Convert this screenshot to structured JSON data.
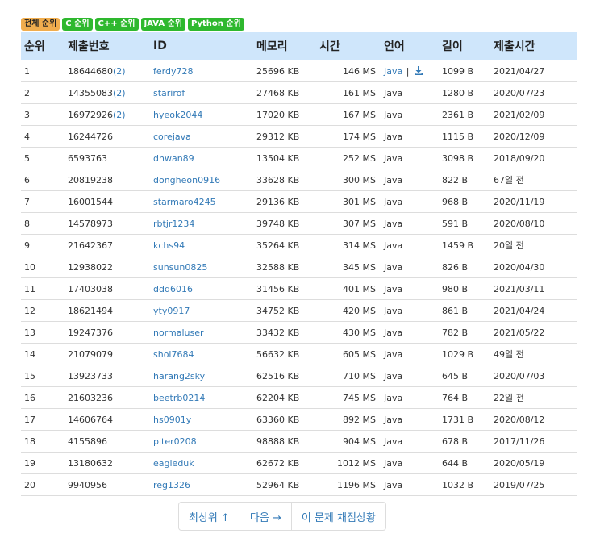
{
  "tabs": [
    {
      "label": "전체 순위",
      "color": "#f0ad4e"
    },
    {
      "label": "C 순위",
      "color": "#2eb82e"
    },
    {
      "label": "C++ 순위",
      "color": "#2eb82e"
    },
    {
      "label": "JAVA 순위",
      "color": "#2eb82e"
    },
    {
      "label": "Python 순위",
      "color": "#2eb82e"
    }
  ],
  "table": {
    "headers": [
      "순위",
      "제출번호",
      "ID",
      "메모리",
      "시간",
      "언어",
      "길이",
      "제출시간"
    ],
    "rows": [
      {
        "rank": "1",
        "submission": "18644680",
        "extra": "(2)",
        "id": "ferdy728",
        "memory": "25696 KB",
        "time": "146 MS",
        "lang": "Java",
        "download": true,
        "length": "1099 B",
        "submitted": "2021/04/27"
      },
      {
        "rank": "2",
        "submission": "14355083",
        "extra": "(2)",
        "id": "starirof",
        "memory": "27468 KB",
        "time": "161 MS",
        "lang": "Java",
        "download": false,
        "length": "1280 B",
        "submitted": "2020/07/23"
      },
      {
        "rank": "3",
        "submission": "16972926",
        "extra": "(2)",
        "id": "hyeok2044",
        "memory": "17020 KB",
        "time": "167 MS",
        "lang": "Java",
        "download": false,
        "length": "2361 B",
        "submitted": "2021/02/09"
      },
      {
        "rank": "4",
        "submission": "16244726",
        "extra": "",
        "id": "corejava",
        "memory": "29312 KB",
        "time": "174 MS",
        "lang": "Java",
        "download": false,
        "length": "1115 B",
        "submitted": "2020/12/09"
      },
      {
        "rank": "5",
        "submission": "6593763",
        "extra": "",
        "id": "dhwan89",
        "memory": "13504 KB",
        "time": "252 MS",
        "lang": "Java",
        "download": false,
        "length": "3098 B",
        "submitted": "2018/09/20"
      },
      {
        "rank": "6",
        "submission": "20819238",
        "extra": "",
        "id": "dongheon0916",
        "memory": "33628 KB",
        "time": "300 MS",
        "lang": "Java",
        "download": false,
        "length": "822 B",
        "submitted": "67일 전"
      },
      {
        "rank": "7",
        "submission": "16001544",
        "extra": "",
        "id": "starmaro4245",
        "memory": "29136 KB",
        "time": "301 MS",
        "lang": "Java",
        "download": false,
        "length": "968 B",
        "submitted": "2020/11/19"
      },
      {
        "rank": "8",
        "submission": "14578973",
        "extra": "",
        "id": "rbtjr1234",
        "memory": "39748 KB",
        "time": "307 MS",
        "lang": "Java",
        "download": false,
        "length": "591 B",
        "submitted": "2020/08/10"
      },
      {
        "rank": "9",
        "submission": "21642367",
        "extra": "",
        "id": "kchs94",
        "memory": "35264 KB",
        "time": "314 MS",
        "lang": "Java",
        "download": false,
        "length": "1459 B",
        "submitted": "20일 전"
      },
      {
        "rank": "10",
        "submission": "12938022",
        "extra": "",
        "id": "sunsun0825",
        "memory": "32588 KB",
        "time": "345 MS",
        "lang": "Java",
        "download": false,
        "length": "826 B",
        "submitted": "2020/04/30"
      },
      {
        "rank": "11",
        "submission": "17403038",
        "extra": "",
        "id": "ddd6016",
        "memory": "31456 KB",
        "time": "401 MS",
        "lang": "Java",
        "download": false,
        "length": "980 B",
        "submitted": "2021/03/11"
      },
      {
        "rank": "12",
        "submission": "18621494",
        "extra": "",
        "id": "yty0917",
        "memory": "34752 KB",
        "time": "420 MS",
        "lang": "Java",
        "download": false,
        "length": "861 B",
        "submitted": "2021/04/24"
      },
      {
        "rank": "13",
        "submission": "19247376",
        "extra": "",
        "id": "normaluser",
        "memory": "33432 KB",
        "time": "430 MS",
        "lang": "Java",
        "download": false,
        "length": "782 B",
        "submitted": "2021/05/22"
      },
      {
        "rank": "14",
        "submission": "21079079",
        "extra": "",
        "id": "shol7684",
        "memory": "56632 KB",
        "time": "605 MS",
        "lang": "Java",
        "download": false,
        "length": "1029 B",
        "submitted": "49일 전"
      },
      {
        "rank": "15",
        "submission": "13923733",
        "extra": "",
        "id": "harang2sky",
        "memory": "62516 KB",
        "time": "710 MS",
        "lang": "Java",
        "download": false,
        "length": "645 B",
        "submitted": "2020/07/03"
      },
      {
        "rank": "16",
        "submission": "21603236",
        "extra": "",
        "id": "beetrb0214",
        "memory": "62204 KB",
        "time": "745 MS",
        "lang": "Java",
        "download": false,
        "length": "764 B",
        "submitted": "22일 전"
      },
      {
        "rank": "17",
        "submission": "14606764",
        "extra": "",
        "id": "hs0901y",
        "memory": "63360 KB",
        "time": "892 MS",
        "lang": "Java",
        "download": false,
        "length": "1731 B",
        "submitted": "2020/08/12"
      },
      {
        "rank": "18",
        "submission": "4155896",
        "extra": "",
        "id": "piter0208",
        "memory": "98888 KB",
        "time": "904 MS",
        "lang": "Java",
        "download": false,
        "length": "678 B",
        "submitted": "2017/11/26"
      },
      {
        "rank": "19",
        "submission": "13180632",
        "extra": "",
        "id": "eagleduk",
        "memory": "62672 KB",
        "time": "1012 MS",
        "lang": "Java",
        "download": false,
        "length": "644 B",
        "submitted": "2020/05/19"
      },
      {
        "rank": "20",
        "submission": "9940956",
        "extra": "",
        "id": "reg1326",
        "memory": "52964 KB",
        "time": "1196 MS",
        "lang": "Java",
        "download": false,
        "length": "1032 B",
        "submitted": "2019/07/25"
      }
    ]
  },
  "pager": {
    "top": "최상위 ↑",
    "next": "다음 →",
    "status": "이 문제 채점상황"
  },
  "icons": {
    "download": "download-icon"
  },
  "colors": {
    "link": "#337ab7",
    "header_bg": "#cfe6fb",
    "active_tab": "#f0ad4e",
    "tab": "#2eb82e"
  }
}
